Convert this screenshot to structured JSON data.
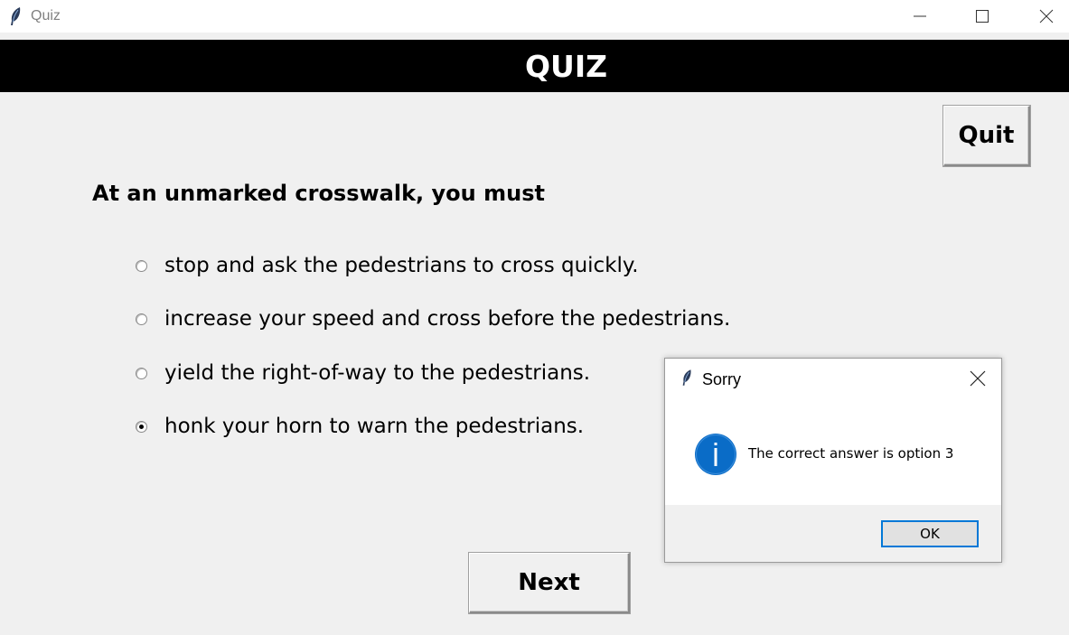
{
  "window": {
    "title": "Quiz",
    "icon": "feather-icon"
  },
  "header": {
    "title": "QUIZ"
  },
  "toolbar": {
    "quit_label": "Quit",
    "next_label": "Next"
  },
  "question": {
    "text": "At an unmarked crosswalk, you must",
    "options": [
      {
        "label": "stop and ask the pedestrians to cross quickly.",
        "selected": false
      },
      {
        "label": "increase your speed and cross before the pedestrians.",
        "selected": false
      },
      {
        "label": "yield the right-of-way to the pedestrians.",
        "selected": false
      },
      {
        "label": "honk your horn to warn the pedestrians.",
        "selected": true
      }
    ]
  },
  "dialog": {
    "title": "Sorry",
    "icon": "info-icon",
    "message": "The correct answer is option 3",
    "ok_label": "OK"
  },
  "colors": {
    "header_bg": "#000000",
    "header_text": "#ffffff",
    "window_bg": "#f0f0f0",
    "info_icon": "#0a6cc7",
    "ok_border": "#0078d7"
  }
}
